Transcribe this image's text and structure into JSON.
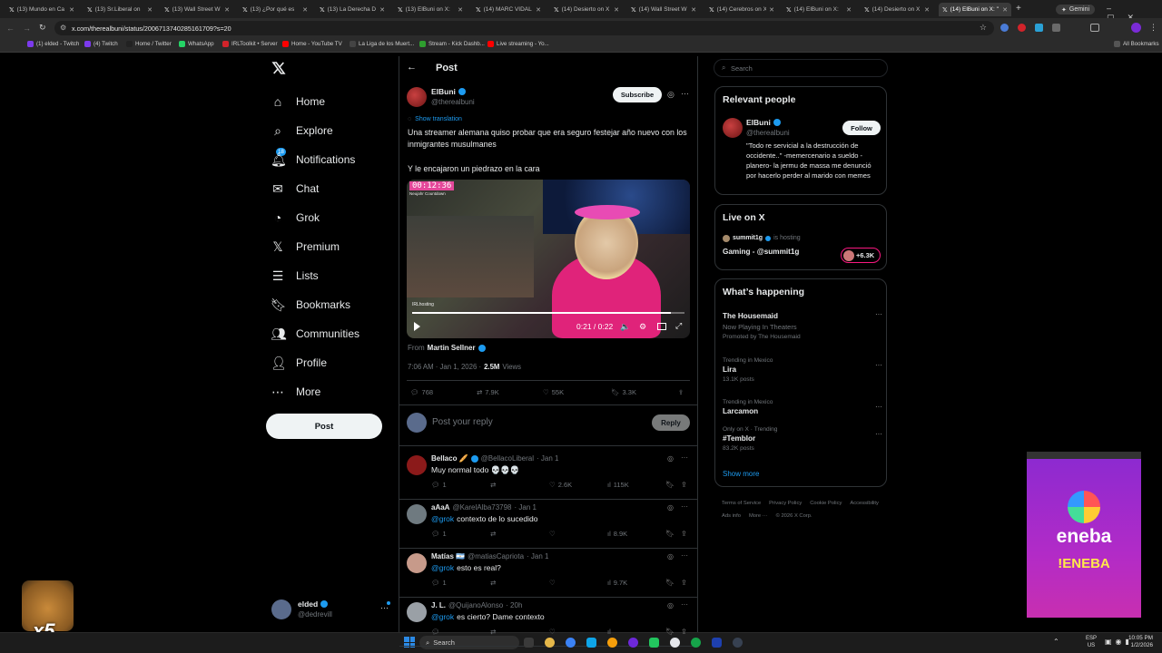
{
  "browser": {
    "tabs": [
      "(13) Mundo en Ca",
      "(13) Sr.Liberal on",
      "(13) Wall Street W",
      "(13) ¿Por qué es",
      "(13) La Derecha D",
      "(13) ElBuni on X:",
      "(14) MARC VIDAL",
      "(14) Desierto on X",
      "(14) Wall Street W",
      "(14) Cerebros on X",
      "(14) ElBuni on X:",
      "(14) Desierto on X",
      "(14) ElBuni on X: \""
    ],
    "gemini": "Gemini",
    "url": "x.com/therealbuni/status/2006713740285161709?s=20",
    "bookmarks": [
      "(1) elded - Twitch",
      "(4) Twitch",
      "Home / Twitter",
      "WhatsApp",
      "IRLToolkit • Server",
      "Home - YouTube TV",
      "La Liga de los Muert...",
      "Stream - Kick Dashb...",
      "Live streaming - Yo..."
    ],
    "all_bookmarks": "All Bookmarks"
  },
  "nav": {
    "items": [
      "Home",
      "Explore",
      "Notifications",
      "Chat",
      "Grok",
      "Premium",
      "Lists",
      "Bookmarks",
      "Communities",
      "Profile",
      "More"
    ],
    "notif_badge": "18",
    "post_button": "Post",
    "account": {
      "name": "elded",
      "handle": "@dedrevill"
    }
  },
  "post": {
    "header": "Post",
    "author": {
      "name": "ElBuni",
      "handle": "@therealbuni"
    },
    "subscribe": "Subscribe",
    "show_translation": "Show translation",
    "text1": "Una streamer alemana quiso probar que era seguro festejar año nuevo con los inmigrantes musulmanes",
    "text2": "Y le encajaron un piedrazo en la cara",
    "video": {
      "countdown": "00:12:36",
      "countdown_sub": "Neujahr Countdown",
      "overlay": "IRLhosting",
      "time": "0:21 / 0:22",
      "progress": 0.95
    },
    "from_label": "From",
    "from_name": "Martin Sellner",
    "meta": "7:06 AM · Jan 1, 2026 ·",
    "views": "2.5M",
    "views_label": "Views",
    "stats": {
      "replies": "768",
      "reposts": "7.9K",
      "likes": "55K",
      "bookmarks": "3.3K"
    },
    "reply_placeholder": "Post your reply",
    "reply_button": "Reply"
  },
  "replies": [
    {
      "name": "Bellaco 🥖",
      "handle": "@BellacoLiberal",
      "time": "· Jan 1",
      "text": "Muy normal todo 💀💀💀",
      "mention": "",
      "replies": "1",
      "reposts": "",
      "likes": "2.6K",
      "views": "115K",
      "color": "#8b1a1a"
    },
    {
      "name": "aAaA",
      "handle": "@KarelAlba73798",
      "time": "· Jan 1",
      "text": "contexto de lo sucedido",
      "mention": "@grok",
      "replies": "1",
      "reposts": "",
      "likes": "",
      "views": "8.9K",
      "color": "#6f7a80"
    },
    {
      "name": "Matías 🇦🇷",
      "handle": "@matiasCapriota",
      "time": "· Jan 1",
      "text": "esto es real?",
      "mention": "@grok",
      "replies": "1",
      "reposts": "",
      "likes": "",
      "views": "9.7K",
      "color": "#c79a8a"
    },
    {
      "name": "J. L.",
      "handle": "@QuijanoAlonso",
      "time": "· 20h",
      "text": "es cierto? Dame contexto",
      "mention": "@grok",
      "replies": "",
      "reposts": "",
      "likes": "",
      "views": "",
      "color": "#9aa0a6"
    }
  ],
  "sidebar": {
    "search_placeholder": "Search",
    "relevant": {
      "title": "Relevant people",
      "name": "ElBuni",
      "handle": "@therealbuni",
      "follow": "Follow",
      "bio": "\"Todo re servicial a la destrucción de occidente..\" -memercenario a sueldo -planero- la jermu de massa me denunció por hacerlo perder al marido con memes"
    },
    "live": {
      "title": "Live on X",
      "host": "summit1g",
      "hosting": "is hosting",
      "stream": "Gaming - @summit1g",
      "viewers": "+6.3K"
    },
    "happening": {
      "title": "What’s happening",
      "items": [
        {
          "name": "The Housemaid",
          "sub": "Now Playing In Theaters",
          "promo": "Promoted by The Housemaid",
          "meta": "",
          "posts": ""
        },
        {
          "meta": "Trending in Mexico",
          "name": "Lira",
          "posts": "13.1K posts",
          "sub": "",
          "promo": ""
        },
        {
          "meta": "Trending in Mexico",
          "name": "Larcamon",
          "posts": "",
          "sub": "",
          "promo": ""
        },
        {
          "meta": "Only on X · Trending",
          "name": "#Temblor",
          "posts": "83.2K posts",
          "sub": "",
          "promo": ""
        }
      ],
      "show_more": "Show more"
    },
    "footer": [
      "Terms of Service",
      "Privacy Policy",
      "Cookie Policy",
      "Accessibility",
      "Ads info",
      "More ···",
      "© 2026 X Corp."
    ]
  },
  "overlay": {
    "brand": "eneba",
    "command": "!ENEBA",
    "cat_multiplier": "x5"
  },
  "taskbar": {
    "search": "Search",
    "lang1": "ESP",
    "lang2": "US",
    "time": "10:05 PM",
    "date": "1/2/2026"
  }
}
